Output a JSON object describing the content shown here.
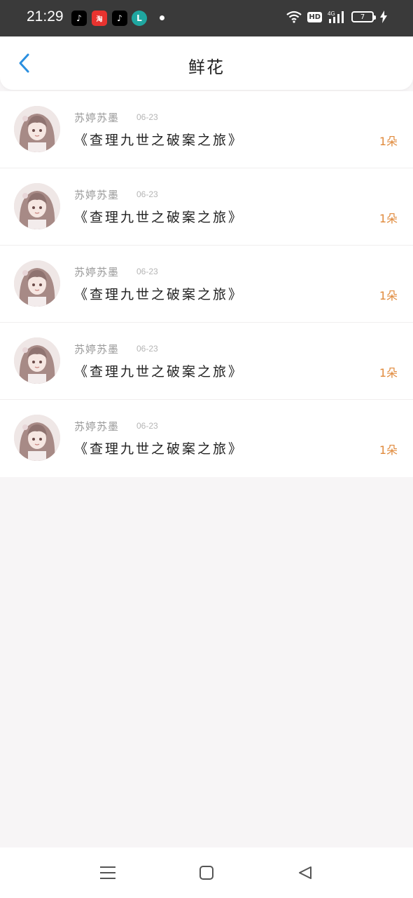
{
  "status_bar": {
    "time": "21:29",
    "app_icons": [
      "tiktok-icon",
      "taobao-icon",
      "tiktok-lite-icon",
      "l-app-icon"
    ],
    "taobao_label": "淘",
    "l_label": "L",
    "network": "4G",
    "hd": "HD",
    "battery": "7"
  },
  "header": {
    "title": "鲜花"
  },
  "rows": [
    {
      "username": "苏婷苏墨",
      "date": "06-23",
      "title": "《查理九世之破案之旅》",
      "count": "1朵"
    },
    {
      "username": "苏婷苏墨",
      "date": "06-23",
      "title": "《查理九世之破案之旅》",
      "count": "1朵"
    },
    {
      "username": "苏婷苏墨",
      "date": "06-23",
      "title": "《查理九世之破案之旅》",
      "count": "1朵"
    },
    {
      "username": "苏婷苏墨",
      "date": "06-23",
      "title": "《查理九世之破案之旅》",
      "count": "1朵"
    },
    {
      "username": "苏婷苏墨",
      "date": "06-23",
      "title": "《查理九世之破案之旅》",
      "count": "1朵"
    }
  ],
  "colors": {
    "accent_blue": "#2a8fe0",
    "count_orange": "#e08a3c",
    "status_bar_bg": "#3a3a3a",
    "page_bg": "#f7f5f6"
  }
}
